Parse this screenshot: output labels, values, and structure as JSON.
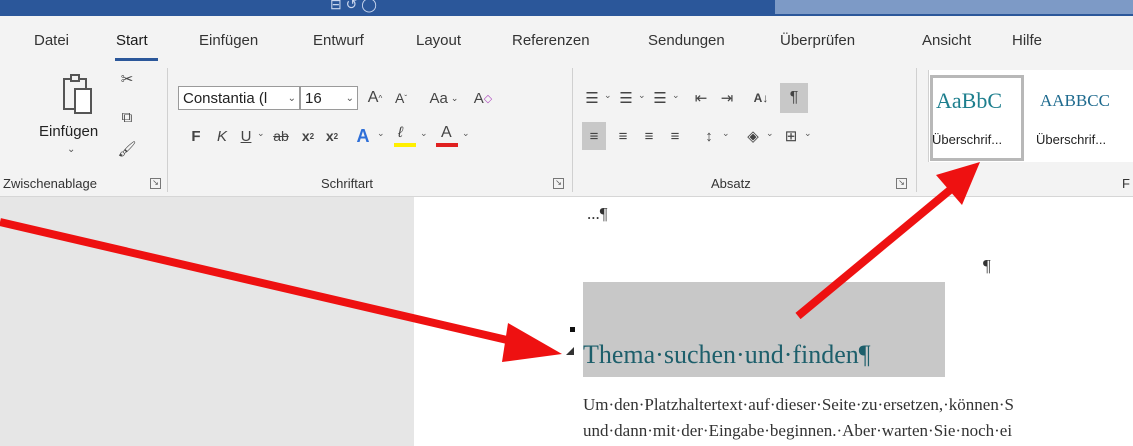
{
  "menu": {
    "tabs": [
      "Datei",
      "Start",
      "Einfügen",
      "Entwurf",
      "Layout",
      "Referenzen",
      "Sendungen",
      "Überprüfen",
      "Ansicht",
      "Hilfe"
    ]
  },
  "ribbon": {
    "clipboard": {
      "paste_label": "Einfügen",
      "group_label": "Zwischenablage"
    },
    "font": {
      "font_name": "Constantia (l",
      "font_size": "16",
      "group_label": "Schriftart",
      "bold": "F",
      "italic": "K",
      "underline": "U",
      "strike": "ab",
      "case_label": "Aa",
      "font_color": "#e02020",
      "highlight_color": "#ffef00"
    },
    "paragraph": {
      "group_label": "Absatz",
      "pilcrow": "¶",
      "sort": "A↓"
    },
    "styles": {
      "group_label": "F",
      "items": [
        {
          "preview": "AaBbC",
          "name": "Überschrif..."
        },
        {
          "preview": "AABBCC",
          "name": "Überschrif..."
        }
      ]
    }
  },
  "document": {
    "ellipsis_line": "...¶",
    "empty_pilcrow": "¶",
    "heading": "Thema·suchen·und·finden¶",
    "heading_color": "#1d5f6b",
    "body_lines": [
      "Um·den·Platzhaltertext·auf·dieser·Seite·zu·ersetzen,·können·S",
      "und·dann·mit·der·Eingabe·beginnen.·Aber·warten·Sie·noch·ei"
    ]
  },
  "annotation_color": "#ee1111"
}
